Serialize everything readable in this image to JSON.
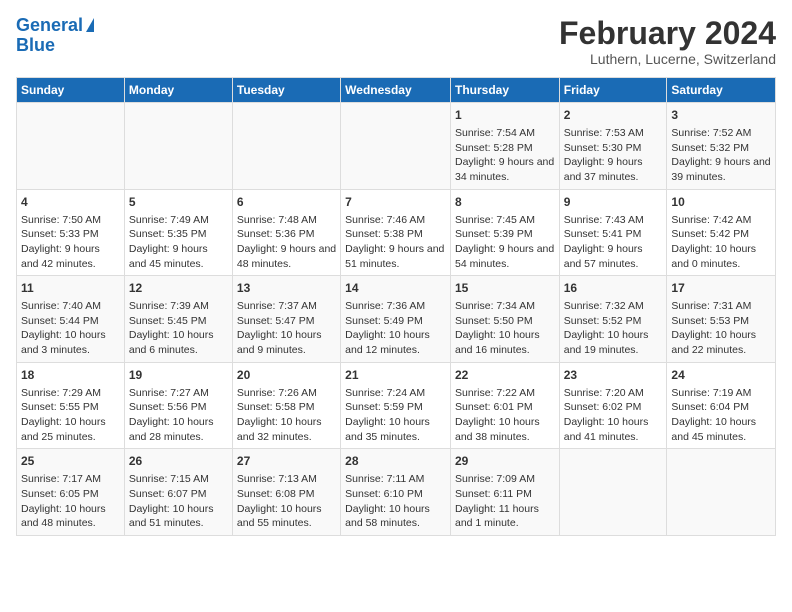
{
  "logo": {
    "line1": "General",
    "line2": "Blue"
  },
  "title": "February 2024",
  "subtitle": "Luthern, Lucerne, Switzerland",
  "days_of_week": [
    "Sunday",
    "Monday",
    "Tuesday",
    "Wednesday",
    "Thursday",
    "Friday",
    "Saturday"
  ],
  "weeks": [
    [
      {
        "day": "",
        "info": ""
      },
      {
        "day": "",
        "info": ""
      },
      {
        "day": "",
        "info": ""
      },
      {
        "day": "",
        "info": ""
      },
      {
        "day": "1",
        "info": "Sunrise: 7:54 AM\nSunset: 5:28 PM\nDaylight: 9 hours and 34 minutes."
      },
      {
        "day": "2",
        "info": "Sunrise: 7:53 AM\nSunset: 5:30 PM\nDaylight: 9 hours and 37 minutes."
      },
      {
        "day": "3",
        "info": "Sunrise: 7:52 AM\nSunset: 5:32 PM\nDaylight: 9 hours and 39 minutes."
      }
    ],
    [
      {
        "day": "4",
        "info": "Sunrise: 7:50 AM\nSunset: 5:33 PM\nDaylight: 9 hours and 42 minutes."
      },
      {
        "day": "5",
        "info": "Sunrise: 7:49 AM\nSunset: 5:35 PM\nDaylight: 9 hours and 45 minutes."
      },
      {
        "day": "6",
        "info": "Sunrise: 7:48 AM\nSunset: 5:36 PM\nDaylight: 9 hours and 48 minutes."
      },
      {
        "day": "7",
        "info": "Sunrise: 7:46 AM\nSunset: 5:38 PM\nDaylight: 9 hours and 51 minutes."
      },
      {
        "day": "8",
        "info": "Sunrise: 7:45 AM\nSunset: 5:39 PM\nDaylight: 9 hours and 54 minutes."
      },
      {
        "day": "9",
        "info": "Sunrise: 7:43 AM\nSunset: 5:41 PM\nDaylight: 9 hours and 57 minutes."
      },
      {
        "day": "10",
        "info": "Sunrise: 7:42 AM\nSunset: 5:42 PM\nDaylight: 10 hours and 0 minutes."
      }
    ],
    [
      {
        "day": "11",
        "info": "Sunrise: 7:40 AM\nSunset: 5:44 PM\nDaylight: 10 hours and 3 minutes."
      },
      {
        "day": "12",
        "info": "Sunrise: 7:39 AM\nSunset: 5:45 PM\nDaylight: 10 hours and 6 minutes."
      },
      {
        "day": "13",
        "info": "Sunrise: 7:37 AM\nSunset: 5:47 PM\nDaylight: 10 hours and 9 minutes."
      },
      {
        "day": "14",
        "info": "Sunrise: 7:36 AM\nSunset: 5:49 PM\nDaylight: 10 hours and 12 minutes."
      },
      {
        "day": "15",
        "info": "Sunrise: 7:34 AM\nSunset: 5:50 PM\nDaylight: 10 hours and 16 minutes."
      },
      {
        "day": "16",
        "info": "Sunrise: 7:32 AM\nSunset: 5:52 PM\nDaylight: 10 hours and 19 minutes."
      },
      {
        "day": "17",
        "info": "Sunrise: 7:31 AM\nSunset: 5:53 PM\nDaylight: 10 hours and 22 minutes."
      }
    ],
    [
      {
        "day": "18",
        "info": "Sunrise: 7:29 AM\nSunset: 5:55 PM\nDaylight: 10 hours and 25 minutes."
      },
      {
        "day": "19",
        "info": "Sunrise: 7:27 AM\nSunset: 5:56 PM\nDaylight: 10 hours and 28 minutes."
      },
      {
        "day": "20",
        "info": "Sunrise: 7:26 AM\nSunset: 5:58 PM\nDaylight: 10 hours and 32 minutes."
      },
      {
        "day": "21",
        "info": "Sunrise: 7:24 AM\nSunset: 5:59 PM\nDaylight: 10 hours and 35 minutes."
      },
      {
        "day": "22",
        "info": "Sunrise: 7:22 AM\nSunset: 6:01 PM\nDaylight: 10 hours and 38 minutes."
      },
      {
        "day": "23",
        "info": "Sunrise: 7:20 AM\nSunset: 6:02 PM\nDaylight: 10 hours and 41 minutes."
      },
      {
        "day": "24",
        "info": "Sunrise: 7:19 AM\nSunset: 6:04 PM\nDaylight: 10 hours and 45 minutes."
      }
    ],
    [
      {
        "day": "25",
        "info": "Sunrise: 7:17 AM\nSunset: 6:05 PM\nDaylight: 10 hours and 48 minutes."
      },
      {
        "day": "26",
        "info": "Sunrise: 7:15 AM\nSunset: 6:07 PM\nDaylight: 10 hours and 51 minutes."
      },
      {
        "day": "27",
        "info": "Sunrise: 7:13 AM\nSunset: 6:08 PM\nDaylight: 10 hours and 55 minutes."
      },
      {
        "day": "28",
        "info": "Sunrise: 7:11 AM\nSunset: 6:10 PM\nDaylight: 10 hours and 58 minutes."
      },
      {
        "day": "29",
        "info": "Sunrise: 7:09 AM\nSunset: 6:11 PM\nDaylight: 11 hours and 1 minute."
      },
      {
        "day": "",
        "info": ""
      },
      {
        "day": "",
        "info": ""
      }
    ]
  ]
}
